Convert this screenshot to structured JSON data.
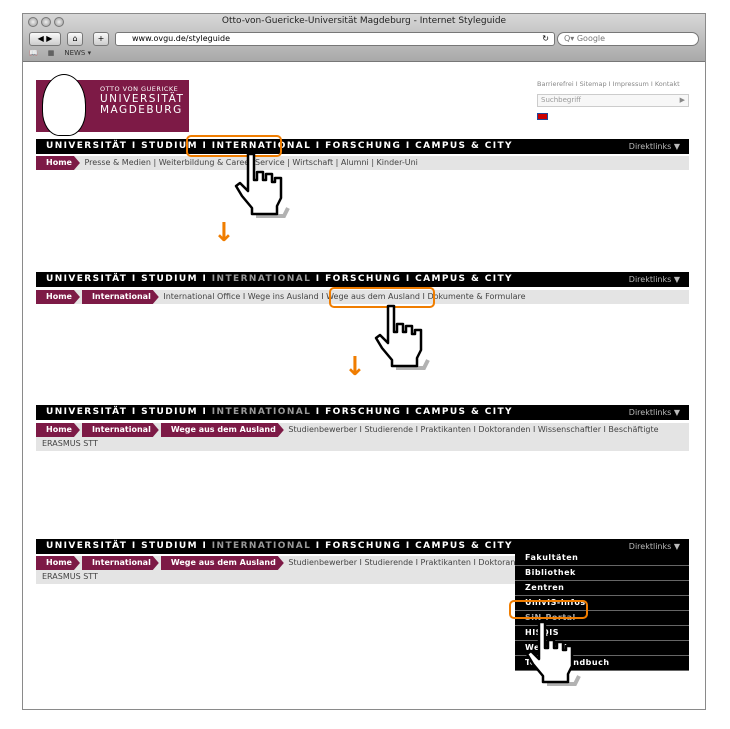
{
  "browser": {
    "title": "Otto-von-Guericke-Universität Magdeburg - Internet Styleguide",
    "url": "www.ovgu.de/styleguide",
    "search_placeholder": "Google",
    "bookmark": "NEWS ▾"
  },
  "logo": {
    "line1": "OTTO VON GUERICKE",
    "line2": "UNIVERSITÄT",
    "line3": "MAGDEBURG"
  },
  "meta_links": "Barrierefrei I Sitemap I Impressum I Kontakt",
  "search": {
    "placeholder": "Suchbegriff"
  },
  "nav": {
    "items": [
      "UNIVERSITÄT",
      "STUDIUM",
      "INTERNATIONAL",
      "FORSCHUNG",
      "CAMPUS & CITY"
    ],
    "sep": "I",
    "direktlinks": "Direktlinks ▼"
  },
  "step1": {
    "home": "Home",
    "links": "Presse & Medien  |  Weiterbildung & Career Service  |  Wirtschaft  |  Alumni  |  Kinder-Uni"
  },
  "step2": {
    "home": "Home",
    "crumb": "International",
    "links": "International Office  I  Wege ins Ausland  I  Wege aus dem Ausland  I  Dokumente & Formulare"
  },
  "step3": {
    "home": "Home",
    "crumb1": "International",
    "crumb2": "Wege aus dem Ausland",
    "links": "Studienbewerber  I  Studierende  I  Praktikanten  I  Doktoranden  I  Wissenschaftler  I  Beschäftigte",
    "line2": "ERASMUS STT"
  },
  "dropdown": [
    "Fakultäten",
    "Bibliothek",
    "Zentren",
    "UnivIS-Infos",
    "SiN-Portal",
    "HISQIS",
    "Webmail",
    "Telefonhandbuch"
  ],
  "colors": {
    "brand": "#7d1a46",
    "highlight": "#f07d00"
  }
}
